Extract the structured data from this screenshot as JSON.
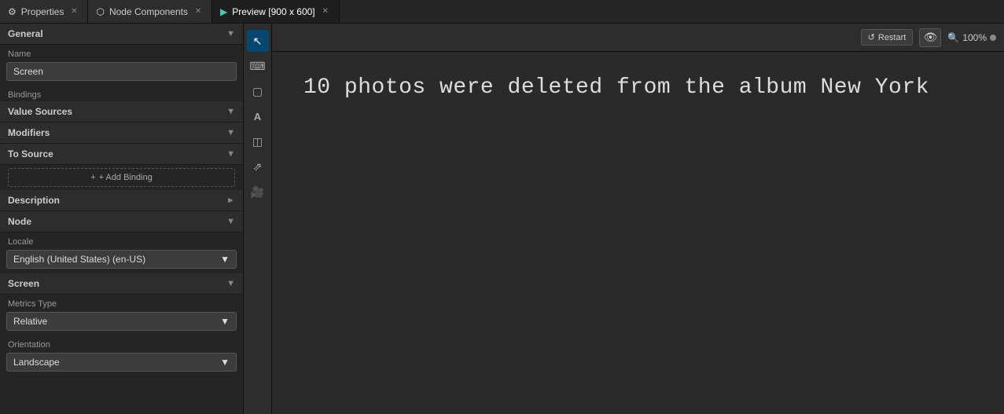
{
  "tabs": [
    {
      "id": "properties",
      "icon": "⚙",
      "label": "Properties",
      "closable": true,
      "active": false
    },
    {
      "id": "node-components",
      "icon": "⬡",
      "label": "Node Components",
      "closable": true,
      "active": false
    },
    {
      "id": "preview",
      "icon": "▶",
      "label": "Preview [900 x 600]",
      "closable": true,
      "active": true
    }
  ],
  "left_panel": {
    "general_section": {
      "title": "General",
      "expanded": true
    },
    "name_label": "Name",
    "name_value": "Screen",
    "bindings_label": "Bindings",
    "value_sources": {
      "label": "Value Sources",
      "expanded": true
    },
    "modifiers": {
      "label": "Modifiers",
      "expanded": true
    },
    "to_source": {
      "label": "To Source",
      "expanded": true
    },
    "add_binding_label": "+ Add Binding",
    "description_section": {
      "title": "Description",
      "expanded": false
    },
    "node_section": {
      "title": "Node",
      "expanded": true
    },
    "locale_label": "Locale",
    "locale_value": "English (United States) (en-US)",
    "screen_section": {
      "title": "Screen",
      "expanded": true
    },
    "metrics_type_label": "Metrics Type",
    "metrics_type_value": "Relative",
    "orientation_label": "Orientation",
    "orientation_value": "Landscape"
  },
  "toolbar": {
    "icons": [
      {
        "id": "cursor",
        "symbol": "↖",
        "active": false
      },
      {
        "id": "select",
        "symbol": "▢",
        "active": false
      },
      {
        "id": "grid",
        "symbol": "⊞",
        "active": false
      },
      {
        "id": "text",
        "symbol": "A",
        "active": false
      },
      {
        "id": "layers",
        "symbol": "◫",
        "active": false
      },
      {
        "id": "share",
        "symbol": "⇗",
        "active": false
      },
      {
        "id": "camera",
        "symbol": "⊡",
        "active": false
      }
    ]
  },
  "preview": {
    "toolbar": {
      "restart_label": "Restart",
      "zoom_label": "100%"
    },
    "content_text": "10 photos were deleted from the album New York"
  }
}
